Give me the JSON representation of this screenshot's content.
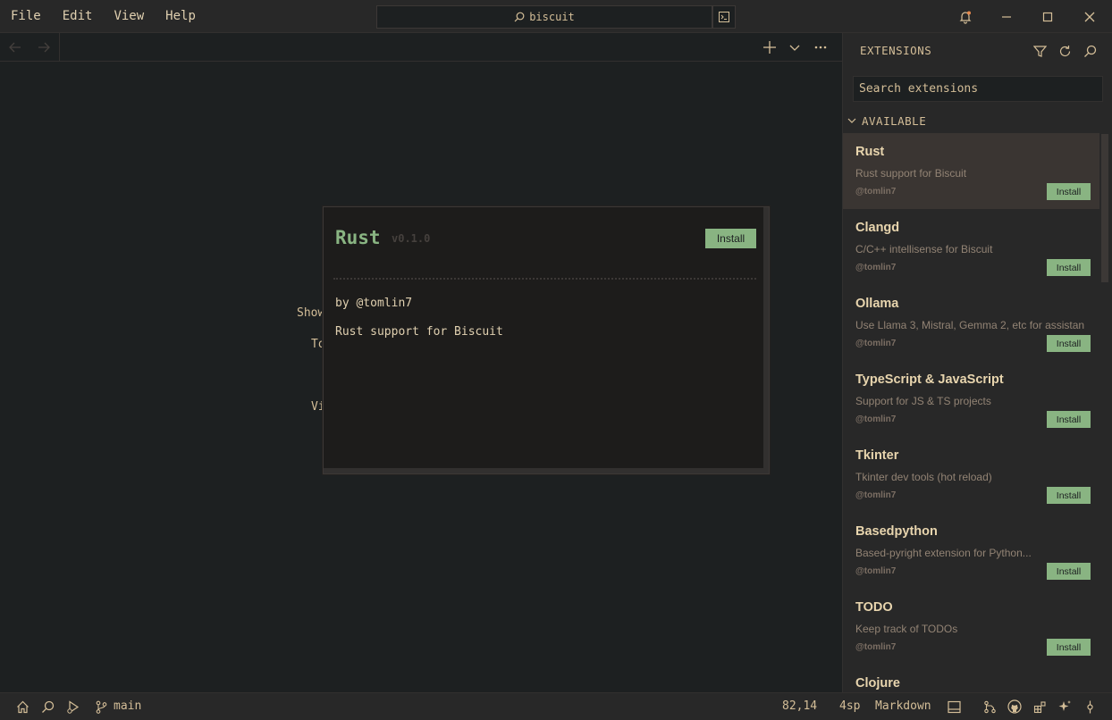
{
  "menu": [
    "File",
    "Edit",
    "View",
    "Help"
  ],
  "command_bar": {
    "query": "biscuit"
  },
  "editor": {
    "hints": [
      {
        "text": "Show"
      },
      {
        "text": "To"
      },
      {
        "text": "Vi"
      }
    ]
  },
  "popup": {
    "name": "Rust",
    "version": "v0.1.0",
    "install_label": "Install",
    "author": "by @tomlin7",
    "description": "Rust support for Biscuit"
  },
  "sidebar": {
    "title": "EXTENSIONS",
    "search_placeholder": "Search extensions",
    "section": "AVAILABLE",
    "extensions": [
      {
        "name": "Rust",
        "description": "Rust support for Biscuit",
        "author": "@tomlin7",
        "install": "Install"
      },
      {
        "name": "Clangd",
        "description": "C/C++ intellisense for Biscuit",
        "author": "@tomlin7",
        "install": "Install"
      },
      {
        "name": "Ollama",
        "description": "Use Llama 3, Mistral, Gemma 2, etc for assistan",
        "author": "@tomlin7",
        "install": "Install"
      },
      {
        "name": "TypeScript & JavaScript",
        "description": "Support for JS & TS projects",
        "author": "@tomlin7",
        "install": "Install"
      },
      {
        "name": "Tkinter",
        "description": "Tkinter dev tools (hot reload)",
        "author": "@tomlin7",
        "install": "Install"
      },
      {
        "name": "Basedpython",
        "description": "Based-pyright extension for Python...",
        "author": "@tomlin7",
        "install": "Install"
      },
      {
        "name": "TODO",
        "description": "Keep track of TODOs",
        "author": "@tomlin7",
        "install": "Install"
      },
      {
        "name": "Clojure",
        "description": "",
        "author": "",
        "install": ""
      }
    ]
  },
  "statusbar": {
    "branch": "main",
    "cursor": "82,14",
    "indent": "4sp",
    "language": "Markdown"
  },
  "colors": {
    "accent": "#89b482",
    "background": "#1d2021",
    "panel": "#282828",
    "text": "#d4be98"
  }
}
